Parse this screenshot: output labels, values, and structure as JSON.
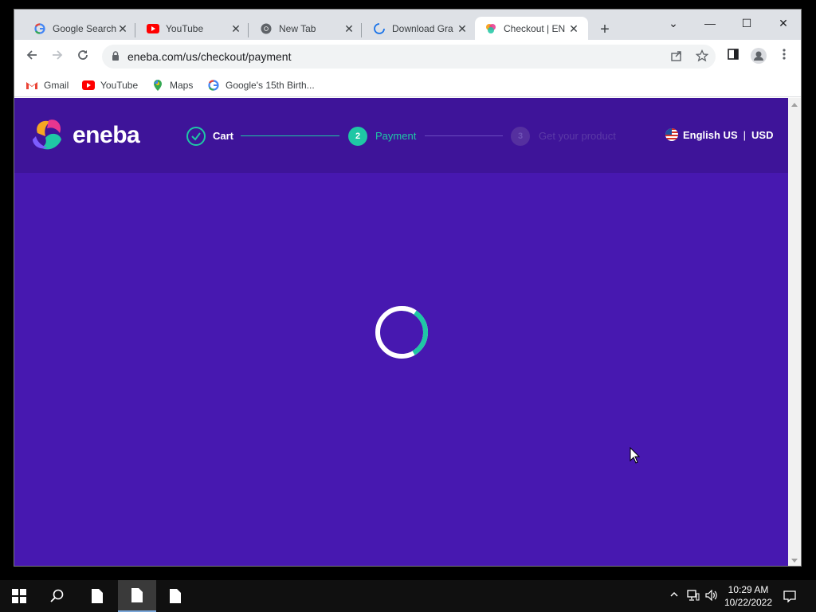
{
  "browser": {
    "tabs": [
      {
        "title": "Google Search",
        "favicon": "google-icon"
      },
      {
        "title": "YouTube",
        "favicon": "youtube-icon"
      },
      {
        "title": "New Tab",
        "favicon": "chrome-icon"
      },
      {
        "title": "Download Gra",
        "favicon": "loading-icon"
      },
      {
        "title": "Checkout | EN",
        "favicon": "eneba-icon",
        "active": true
      }
    ],
    "new_tab_label": "+",
    "window_controls": {
      "dropdown": "⌄",
      "minimize": "—",
      "maximize": "☐",
      "close": "✕"
    },
    "url": "eneba.com/us/checkout/payment",
    "bookmarks": [
      {
        "label": "Gmail",
        "icon": "gmail-icon"
      },
      {
        "label": "YouTube",
        "icon": "youtube-icon"
      },
      {
        "label": "Maps",
        "icon": "maps-icon"
      },
      {
        "label": "Google's 15th Birth...",
        "icon": "google-icon"
      }
    ]
  },
  "site": {
    "logo_text": "eneba",
    "steps": [
      {
        "number": "",
        "label": "Cart",
        "state": "done"
      },
      {
        "number": "2",
        "label": "Payment",
        "state": "active"
      },
      {
        "number": "3",
        "label": "Get your product",
        "state": "pending"
      }
    ],
    "language": "English US",
    "currency": "USD",
    "colors": {
      "background": "#4718b0",
      "header": "#3e1499",
      "accent": "#1fc7a5"
    }
  },
  "taskbar": {
    "time": "10:29 AM",
    "date": "10/22/2022"
  }
}
